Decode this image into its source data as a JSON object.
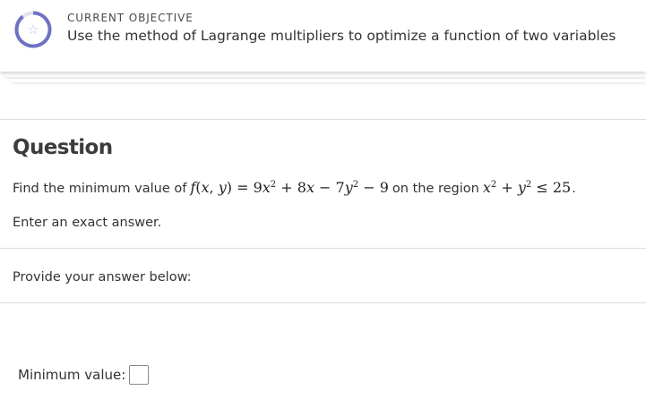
{
  "objective": {
    "eyebrow": "CURRENT OBJECTIVE",
    "text": "Use the method of Lagrange multipliers to optimize a function of two variables",
    "icon": "star-icon",
    "ring_color": "#6e72c4"
  },
  "question": {
    "heading": "Question",
    "prompt_before": "Find the minimum value of",
    "function_tex": "f(x, y) = 9x^2 + 8x − 7y^2 − 9",
    "prompt_middle": "on the region",
    "region_tex": "x^2 + y^2 ≤ 25",
    "prompt_end": ".",
    "instruction": "Enter an exact answer."
  },
  "answer": {
    "provide_label": "Provide your answer below:",
    "field_label": "Minimum value:",
    "value": ""
  }
}
